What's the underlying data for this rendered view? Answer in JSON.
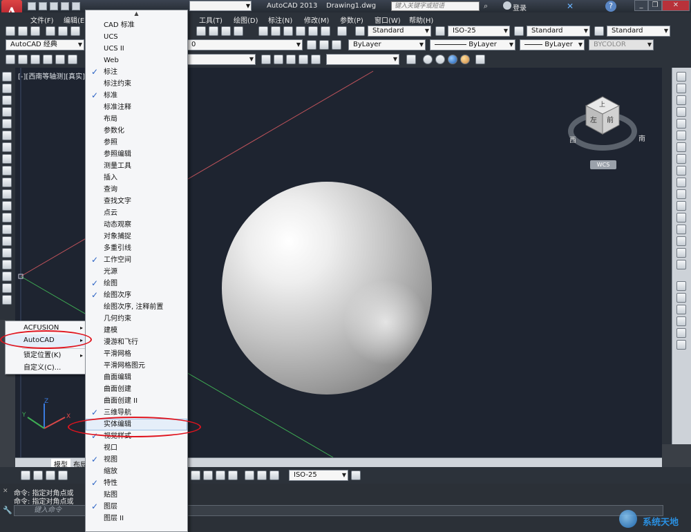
{
  "titlebar": {
    "app_logo": "A",
    "workspace": "AutoCAD 经典",
    "app_name": "AutoCAD 2013",
    "doc_name": "Drawing1.dwg",
    "search_placeholder": "键入关键字或短语",
    "login": "登录",
    "minimize": "_",
    "restore": "❐",
    "close": "✕"
  },
  "menubar": {
    "items": [
      "文件(F)",
      "编辑(E)",
      "工具(T)",
      "绘图(D)",
      "标注(N)",
      "修改(M)",
      "参数(P)",
      "窗口(W)",
      "帮助(H)"
    ]
  },
  "toolbar1": {
    "text_style": "Standard",
    "dim_style": "ISO-25",
    "table_style": "Standard",
    "mleader_style": "Standard"
  },
  "toolbar2": {
    "workspace": "AutoCAD 经典",
    "layer": "0",
    "color": "ByLayer",
    "linetype": "ByLayer",
    "lineweight": "ByLayer",
    "plotstyle": "BYCOLOR"
  },
  "viewport_label": "[-][西南等轴测][真实]",
  "viewcube": {
    "top_face": "上",
    "left_face": "左",
    "front_face": "前",
    "compass_west": "西",
    "compass_south": "南",
    "wcs": "WCS"
  },
  "ucs_axes": {
    "x": "X",
    "y": "Y",
    "z": "Z"
  },
  "tabs": {
    "model": "模型",
    "layout": "布局"
  },
  "bottom_toolbar": {
    "dim_style": "ISO-25"
  },
  "command": {
    "history": [
      "命令: 指定对角点或",
      "命令: 指定对角点或"
    ],
    "input_placeholder": "键入命令"
  },
  "context_menu": {
    "items": [
      {
        "label": "ACFUSION",
        "has_submenu": true
      },
      {
        "label": "AutoCAD",
        "has_submenu": true
      },
      {
        "label": "锁定位置(K)",
        "has_submenu": true
      },
      {
        "label": "自定义(C)...",
        "has_submenu": false
      }
    ],
    "arrow": "▸"
  },
  "submenu": {
    "scroll_up": "▲",
    "check_glyph": "✓",
    "items": [
      {
        "label": "CAD 标准",
        "checked": false
      },
      {
        "label": "UCS",
        "checked": false
      },
      {
        "label": "UCS II",
        "checked": false
      },
      {
        "label": "Web",
        "checked": false
      },
      {
        "label": "标注",
        "checked": true
      },
      {
        "label": "标注约束",
        "checked": false
      },
      {
        "label": "标准",
        "checked": true
      },
      {
        "label": "标准注释",
        "checked": false
      },
      {
        "label": "布局",
        "checked": false
      },
      {
        "label": "参数化",
        "checked": false
      },
      {
        "label": "参照",
        "checked": false
      },
      {
        "label": "参照编辑",
        "checked": false
      },
      {
        "label": "测量工具",
        "checked": false
      },
      {
        "label": "插入",
        "checked": false
      },
      {
        "label": "查询",
        "checked": false
      },
      {
        "label": "查找文字",
        "checked": false
      },
      {
        "label": "点云",
        "checked": false
      },
      {
        "label": "动态观察",
        "checked": false
      },
      {
        "label": "对象捕捉",
        "checked": false
      },
      {
        "label": "多重引线",
        "checked": false
      },
      {
        "label": "工作空间",
        "checked": true
      },
      {
        "label": "光源",
        "checked": false
      },
      {
        "label": "绘图",
        "checked": true
      },
      {
        "label": "绘图次序",
        "checked": true
      },
      {
        "label": "绘图次序, 注释前置",
        "checked": false
      },
      {
        "label": "几何约束",
        "checked": false
      },
      {
        "label": "建模",
        "checked": false
      },
      {
        "label": "漫游和飞行",
        "checked": false
      },
      {
        "label": "平滑网格",
        "checked": false
      },
      {
        "label": "平滑网格图元",
        "checked": false
      },
      {
        "label": "曲面编辑",
        "checked": false
      },
      {
        "label": "曲面创建",
        "checked": false
      },
      {
        "label": "曲面创建 II",
        "checked": false
      },
      {
        "label": "三维导航",
        "checked": true
      },
      {
        "label": "实体编辑",
        "checked": false,
        "highlighted": true
      },
      {
        "label": "视觉样式",
        "checked": true
      },
      {
        "label": "视口",
        "checked": false
      },
      {
        "label": "视图",
        "checked": true
      },
      {
        "label": "缩放",
        "checked": false
      },
      {
        "label": "特性",
        "checked": true
      },
      {
        "label": "贴图",
        "checked": false
      },
      {
        "label": "图层",
        "checked": true
      },
      {
        "label": "图层 II",
        "checked": false
      }
    ]
  },
  "watermark": "系统天地",
  "colors": {
    "annotation_red": "#e0141e",
    "drawing_bg": "#1e2430",
    "chrome_dark": "#2c323a",
    "axis_red": "#c0535b",
    "axis_green": "#3fae54"
  }
}
